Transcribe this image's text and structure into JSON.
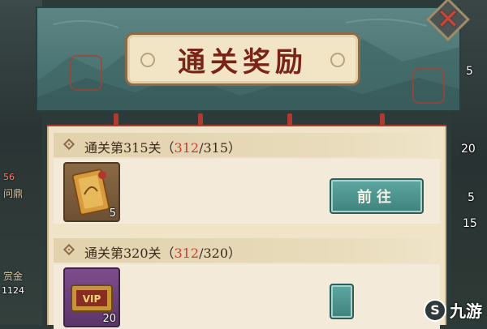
{
  "dialog": {
    "title": "通关奖励",
    "close_icon": "close-x-icon",
    "accent_red": "#d23a2e",
    "teal_button": "#4b908a"
  },
  "rewards": [
    {
      "prefix": "通关第315关（",
      "current": "312",
      "rest": "/315）",
      "item_icon": "scroll-token-icon",
      "count": "5",
      "button_label": "前往"
    },
    {
      "prefix": "通关第320关（",
      "current": "312",
      "rest": "/320）",
      "item_icon": "vip-card-icon",
      "count": "20",
      "button_label": ""
    }
  ],
  "background": {
    "left_labels": [
      "问鼎",
      "赏金"
    ],
    "left_numbers": [
      "56",
      "1124"
    ],
    "right_numbers": [
      "5",
      "20",
      "5",
      "15"
    ]
  },
  "watermark": {
    "logo": "S",
    "text": "九游"
  }
}
